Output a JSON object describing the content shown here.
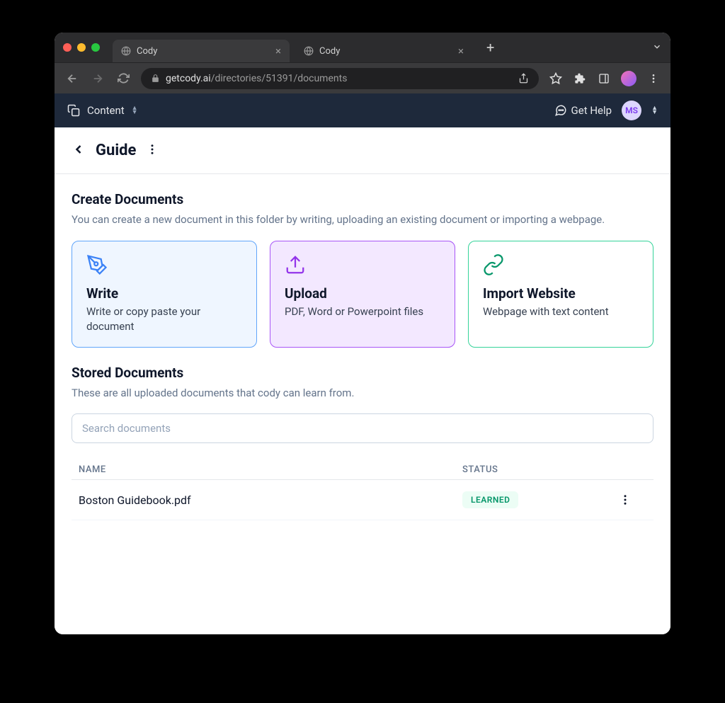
{
  "browser": {
    "tabs": [
      {
        "title": "Cody",
        "active": true
      },
      {
        "title": "Cody",
        "active": false
      }
    ],
    "url_host": "getcody.ai",
    "url_path": "/directories/51391/documents"
  },
  "appbar": {
    "content_label": "Content",
    "help_label": "Get Help",
    "avatar_initials": "MS"
  },
  "breadcrumb": {
    "title": "Guide"
  },
  "create": {
    "heading": "Create Documents",
    "subtext": "You can create a new document in this folder by writing, uploading an existing document or importing a webpage.",
    "cards": [
      {
        "title": "Write",
        "desc": "Write or copy paste your document"
      },
      {
        "title": "Upload",
        "desc": "PDF, Word or Powerpoint files"
      },
      {
        "title": "Import Website",
        "desc": "Webpage with text content"
      }
    ]
  },
  "stored": {
    "heading": "Stored Documents",
    "subtext": "These are all uploaded documents that cody can learn from.",
    "search_placeholder": "Search documents",
    "columns": {
      "name": "NAME",
      "status": "STATUS"
    },
    "rows": [
      {
        "name": "Boston Guidebook.pdf",
        "status": "LEARNED"
      }
    ]
  }
}
